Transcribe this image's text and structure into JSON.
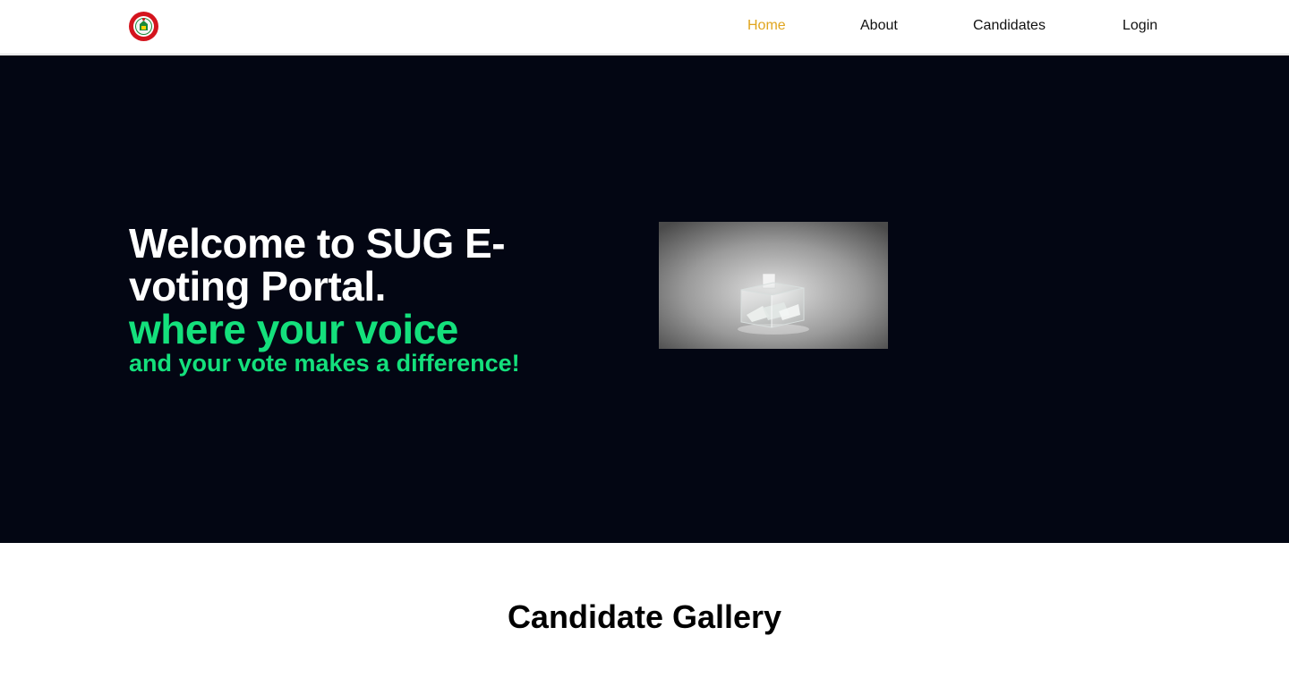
{
  "nav": {
    "logo_icon": "university-crest-icon",
    "links": [
      {
        "label": "Home",
        "active": true
      },
      {
        "label": "About",
        "active": false
      },
      {
        "label": "Candidates",
        "active": false
      },
      {
        "label": "Login",
        "active": false
      }
    ]
  },
  "hero": {
    "title": "Welcome to SUG E-voting Portal.",
    "tagline_1": "where your voice",
    "tagline_2": "and your vote makes a difference!",
    "image_icon": "ballot-box-image"
  },
  "gallery": {
    "title": "Candidate Gallery"
  },
  "colors": {
    "hero_bg": "#030613",
    "accent_green": "#14e07c",
    "active_link": "#e0a51f",
    "logo_red": "#d4141d"
  }
}
